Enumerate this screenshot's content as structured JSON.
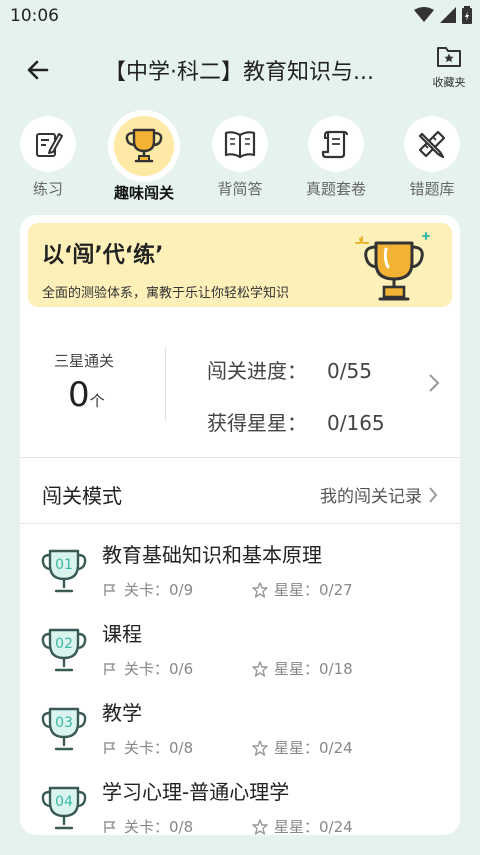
{
  "status": {
    "time": "10:06"
  },
  "header": {
    "title": "【中学·科二】教育知识与...",
    "favorite_label": "收藏夹"
  },
  "tabs": [
    {
      "label": "练习",
      "icon": "pencil-paper-icon"
    },
    {
      "label": "趣味闯关",
      "icon": "trophy-icon",
      "active": true
    },
    {
      "label": "背简答",
      "icon": "book-icon"
    },
    {
      "label": "真题套卷",
      "icon": "scroll-icon"
    },
    {
      "label": "错题库",
      "icon": "pencil-ruler-icon"
    }
  ],
  "banner": {
    "title": "以‘闯’代‘练’",
    "subtitle": "全面的测验体系，寓教于乐让你轻松学知识"
  },
  "stats": {
    "three_star_label": "三星通关",
    "three_star_value": "0",
    "three_star_unit": "个",
    "progress_label": "闯关进度：",
    "progress_value": "0/55",
    "stars_label": "获得星星：",
    "stars_value": "0/165"
  },
  "mode": {
    "title": "闯关模式",
    "record_link": "我的闯关记录"
  },
  "levels": [
    {
      "num": "01",
      "name": "教育基础知识和基本原理",
      "stages": "关卡：0/9",
      "stars": "星星：0/27"
    },
    {
      "num": "02",
      "name": "课程",
      "stages": "关卡：0/6",
      "stars": "星星：0/18"
    },
    {
      "num": "03",
      "name": "教学",
      "stages": "关卡：0/8",
      "stars": "星星：0/24"
    },
    {
      "num": "04",
      "name": "学习心理-普通心理学",
      "stages": "关卡：0/8",
      "stars": "星星：0/24"
    }
  ],
  "colors": {
    "background": "#e6f3ed",
    "accent": "#3bb8a3",
    "banner": "#fdf0b8",
    "trophy": "#f2b233"
  }
}
